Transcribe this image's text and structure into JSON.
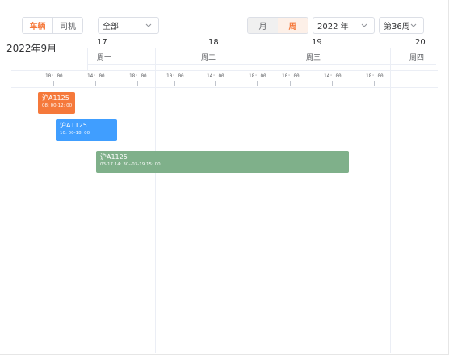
{
  "toolbar": {
    "mode_tabs": [
      {
        "label": "车辆",
        "active": true
      },
      {
        "label": "司机",
        "active": false
      }
    ],
    "filter_select": {
      "value": "全部"
    },
    "period_tabs": [
      {
        "label": "月",
        "active": false
      },
      {
        "label": "周",
        "active": true
      }
    ],
    "year_select": {
      "value": "2022 年"
    },
    "week_select": {
      "value": "第36周"
    }
  },
  "calendar": {
    "month_title": "2022年9月",
    "days": [
      {
        "num": "17",
        "name": "周一"
      },
      {
        "num": "18",
        "name": "周二"
      },
      {
        "num": "19",
        "name": "周三"
      },
      {
        "num": "20",
        "name": "周四"
      }
    ],
    "ticks": [
      "10: 00",
      "14: 00",
      "18: 00",
      "10: 00",
      "14: 00",
      "18: 00",
      "10: 00",
      "14: 00",
      "18: 00"
    ]
  },
  "bookings": [
    {
      "plate": "沪A1125",
      "time": "08: 00-12: 00",
      "color": "#f5793b"
    },
    {
      "plate": "沪A1125",
      "time": "10: 00-18: 00",
      "color": "#409eff"
    },
    {
      "plate": "沪A1125",
      "time": "03-17 14: 30--03-19 15: 00",
      "color": "#7fb08a"
    }
  ],
  "colors": {
    "accent": "#f5793b",
    "grid": "#ebeef5"
  }
}
